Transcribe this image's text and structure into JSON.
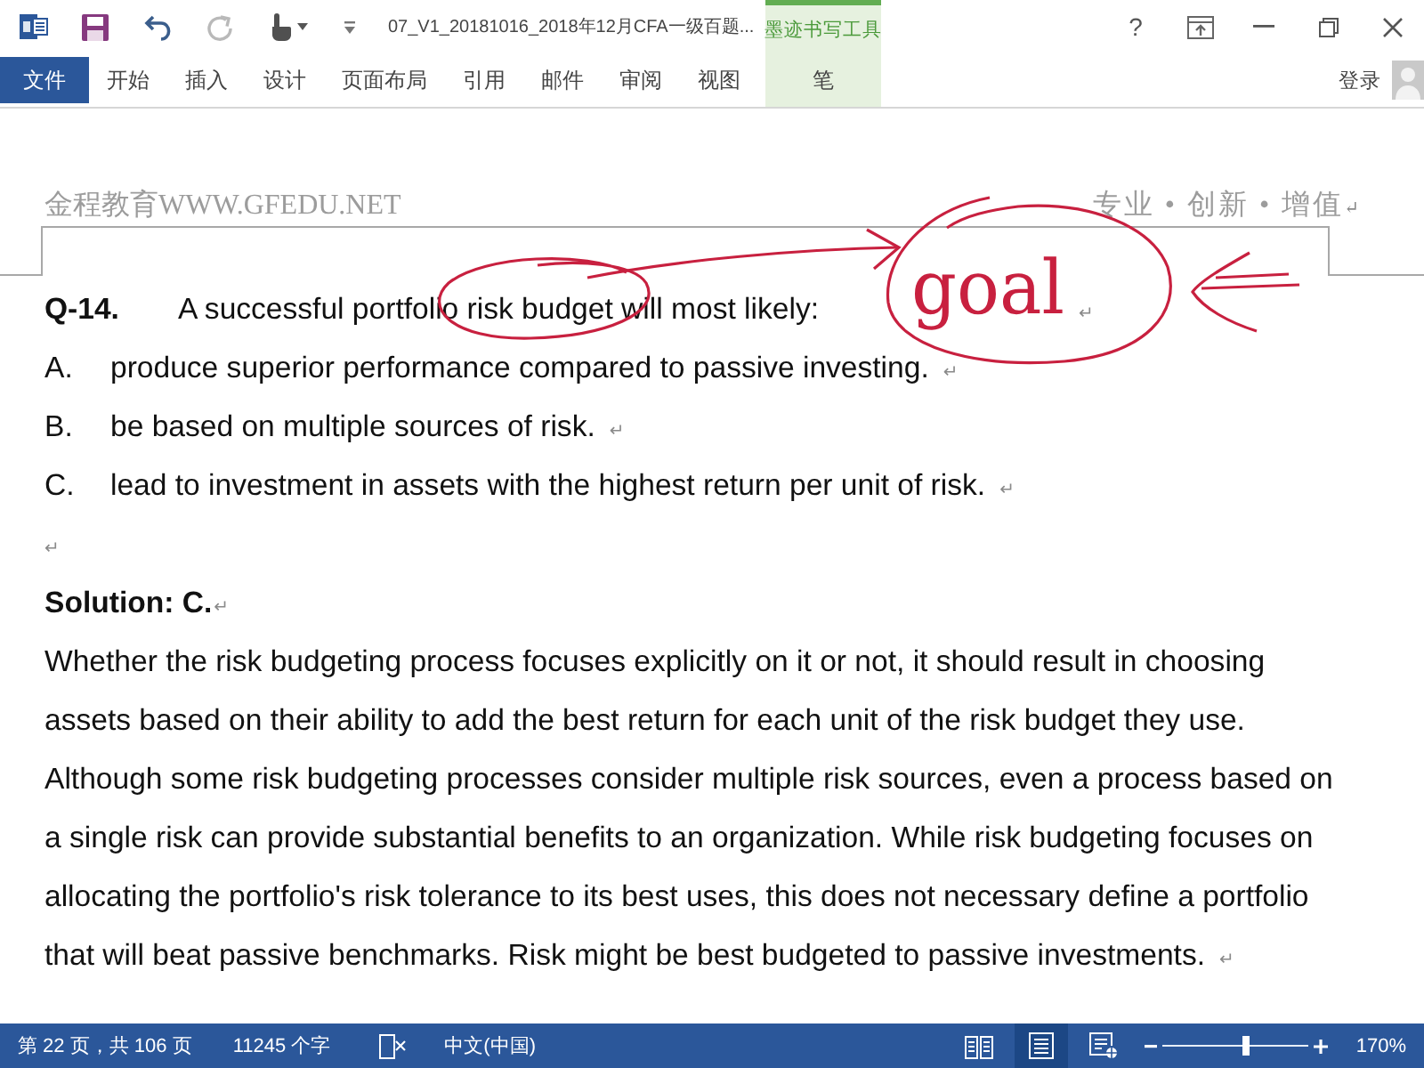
{
  "title_bar": {
    "quick_access": [
      {
        "kind": "app"
      },
      {
        "kind": "save"
      },
      {
        "kind": "undo",
        "disabled": false
      },
      {
        "kind": "redo",
        "disabled": true
      },
      {
        "kind": "touch"
      },
      {
        "kind": "customize"
      }
    ],
    "title": "07_V1_20181016_2018年12月CFA一级百题...",
    "help": "?"
  },
  "ribbon": {
    "tabs": [
      {
        "label": "文件",
        "kind": "file",
        "selected": false
      },
      {
        "label": "开始",
        "kind": "tab",
        "selected": false
      },
      {
        "label": "插入",
        "kind": "tab",
        "selected": false
      },
      {
        "label": "设计",
        "kind": "tab",
        "selected": false
      },
      {
        "label": "页面布局",
        "kind": "tab",
        "selected": false
      },
      {
        "label": "引用",
        "kind": "tab",
        "selected": false
      },
      {
        "label": "邮件",
        "kind": "tab",
        "selected": false
      },
      {
        "label": "审阅",
        "kind": "tab",
        "selected": false
      },
      {
        "label": "视图",
        "kind": "tab",
        "selected": false
      }
    ],
    "contextual_group": {
      "label": "墨迹书写工具",
      "tabs": [
        {
          "label": "笔",
          "selected": false
        }
      ]
    },
    "sign_in": "登录"
  },
  "document": {
    "header": {
      "left": "金程教育WWW.GFEDU.NET",
      "right": "专业 • 创新 • 增值",
      "mark": "↵"
    },
    "question": {
      "number": "Q-14.",
      "text": "A successful portfolio risk budget will most likely:",
      "mark": "↵"
    },
    "options": [
      {
        "letter": "A.",
        "text": "produce superior performance compared to passive investing.",
        "mark": "↵"
      },
      {
        "letter": "B.",
        "text": "be based on multiple sources of risk.",
        "mark": "↵"
      },
      {
        "letter": "C.",
        "text": "lead to investment in assets with the highest return per unit of risk.",
        "mark": "↵"
      }
    ],
    "blank_paragraph": {
      "mark": "↵"
    },
    "solution": {
      "label": "Solution: C.",
      "mark": "↵",
      "lines": [
        "Whether the risk budgeting process focuses explicitly on it or not, it should result in choosing",
        "assets based on their ability to add the best return for each unit of the risk budget they use.",
        "Although some risk budgeting processes consider multiple risk sources, even a process based on",
        "a single risk can provide substantial benefits to an organization. While risk budgeting focuses on",
        "allocating the portfolio's risk tolerance to its best uses, this does not necessary define a portfolio",
        "that will beat passive benchmarks. Risk might be best budgeted to passive investments."
      ],
      "end_mark": "↵"
    },
    "ink_note": "goal"
  },
  "status_bar": {
    "page_info": "第 22 页，共 106 页",
    "word_count": "11245 个字",
    "language": "中文(中国)",
    "views": [
      {
        "kind": "read",
        "selected": false
      },
      {
        "kind": "print",
        "selected": true
      },
      {
        "kind": "web",
        "selected": false
      }
    ],
    "zoom": {
      "level": 0.58,
      "reading": "170%"
    }
  }
}
